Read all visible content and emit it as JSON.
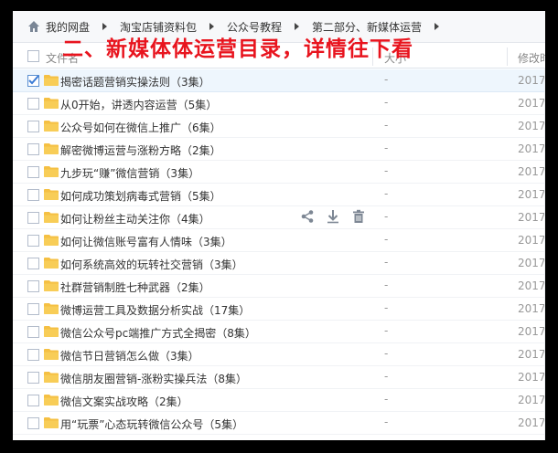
{
  "breadcrumb": {
    "items": [
      "我的网盘",
      "淘宝店铺资料包",
      "公众号教程",
      "第二部分、新媒体运营"
    ]
  },
  "header": {
    "name_label": "文件名",
    "size_label": "大小",
    "date_label": "修改时间"
  },
  "banner": {
    "text": "二、新媒体体运营目录，详情往下看"
  },
  "files": [
    {
      "name": "揭密话题营销实操法则（3集）",
      "size": "-",
      "date": "2017",
      "selected": true
    },
    {
      "name": "从0开始，讲透内容运营（5集）",
      "size": "-",
      "date": "2017"
    },
    {
      "name": "公众号如何在微信上推广（6集）",
      "size": "-",
      "date": "2017"
    },
    {
      "name": "解密微博运营与涨粉方略（2集）",
      "size": "-",
      "date": "2017"
    },
    {
      "name": "九步玩“赚”微信营销（3集）",
      "size": "-",
      "date": "2017"
    },
    {
      "name": "如何成功策划病毒式营销（5集）",
      "size": "-",
      "date": "2017"
    },
    {
      "name": "如何让粉丝主动关注你（4集）",
      "size": "-",
      "date": "2017",
      "hovered": true
    },
    {
      "name": "如何让微信账号富有人情味（3集）",
      "size": "-",
      "date": "2017"
    },
    {
      "name": "如何系统高效的玩转社交营销（3集）",
      "size": "-",
      "date": "2017"
    },
    {
      "name": "社群营销制胜七种武器（2集）",
      "size": "-",
      "date": "2017"
    },
    {
      "name": "微博运营工具及数据分析实战（17集）",
      "size": "-",
      "date": "2017"
    },
    {
      "name": "微信公众号pc端推广方式全揭密（8集）",
      "size": "-",
      "date": "2017"
    },
    {
      "name": "微信节日营销怎么做（3集）",
      "size": "-",
      "date": "2017"
    },
    {
      "name": "微信朋友圈营销-涨粉实操兵法（8集）",
      "size": "-",
      "date": "2017"
    },
    {
      "name": "微信文案实战攻略（2集）",
      "size": "-",
      "date": "2017"
    },
    {
      "name": "用“玩票”心态玩转微信公众号（5集）",
      "size": "-",
      "date": "2017"
    }
  ],
  "icons": {
    "home": "home-icon",
    "folder": "folder-icon",
    "share": "share-icon",
    "download": "download-icon",
    "delete": "trash-icon"
  },
  "colors": {
    "banner": "#e8141e",
    "folder": "#f5c043",
    "selected_row": "#eef6fd"
  }
}
